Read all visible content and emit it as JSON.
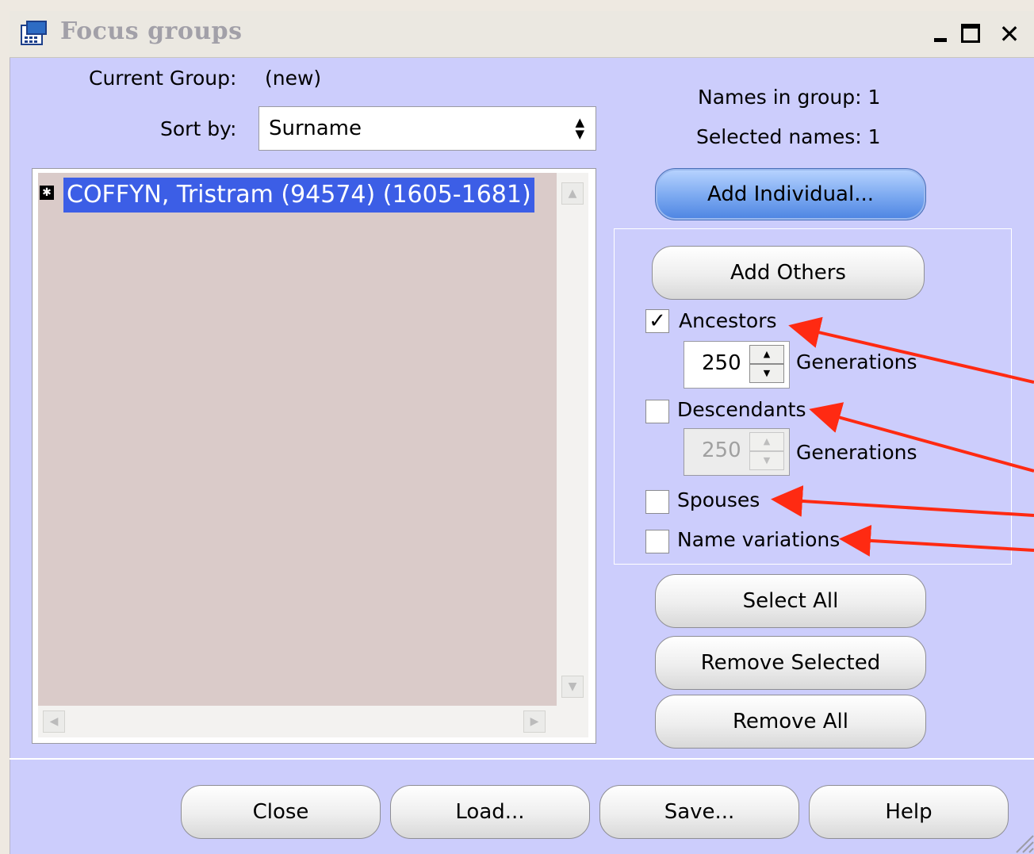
{
  "window": {
    "title": "Focus groups"
  },
  "header": {
    "current_group_label": "Current Group:",
    "current_group_value": "(new)",
    "sort_by_label": "Sort by:",
    "sort_by_value": "Surname"
  },
  "stats": {
    "names_in_group": "Names in group: 1",
    "selected_names": "Selected names: 1"
  },
  "list": {
    "items": [
      {
        "label": "COFFYN, Tristram (94574) (1605-1681)",
        "selected": true
      }
    ]
  },
  "buttons": {
    "add_individual": "Add Individual...",
    "add_others": "Add Others",
    "select_all": "Select All",
    "remove_selected": "Remove Selected",
    "remove_all": "Remove All",
    "close": "Close",
    "load": "Load...",
    "save": "Save...",
    "help": "Help"
  },
  "options": {
    "ancestors": {
      "label": "Ancestors",
      "checked": true,
      "generations": "250",
      "generations_label": "Generations"
    },
    "descendants": {
      "label": "Descendants",
      "checked": false,
      "generations": "250",
      "generations_label": "Generations"
    },
    "spouses": {
      "label": "Spouses",
      "checked": false
    },
    "name_variations": {
      "label": "Name variations",
      "checked": false
    }
  },
  "colors": {
    "dialog_bg": "#cccdfc",
    "selection": "#3c5ee6",
    "annotation_arrow": "#ff2a12"
  }
}
